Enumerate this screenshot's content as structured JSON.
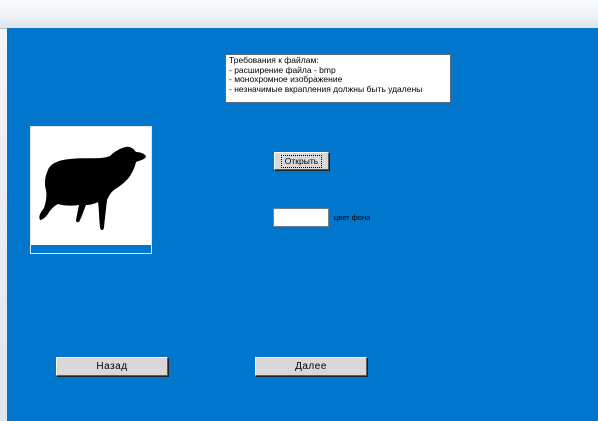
{
  "requirements": {
    "lines": [
      "Требования к файлам:",
      "- расширение файла - bmp",
      "- монохромное изображение",
      "- незначимые вкрапления должны быть удалены"
    ]
  },
  "preview": {
    "icon": "sheep-silhouette-icon"
  },
  "open_button": {
    "label": "Открыть"
  },
  "background_color": {
    "value": "",
    "label": "цвет фона"
  },
  "navigation": {
    "back_label": "Назад",
    "next_label": "Далее"
  },
  "colors": {
    "window_background": "#0077cc",
    "button_face": "#d8d8d8"
  }
}
